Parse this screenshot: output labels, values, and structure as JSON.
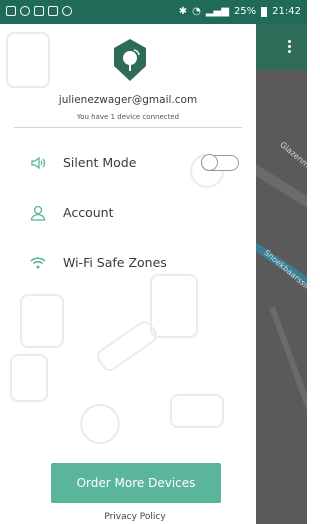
{
  "status_bar": {
    "left_icons": [
      "gallery-icon",
      "whatsapp-icon",
      "image-icon",
      "instagram-icon",
      "chrome-icon"
    ],
    "battery": "25%",
    "time": "21:42"
  },
  "drawer": {
    "email": "julienezwager@gmail.com",
    "devices_text": "You have 1 device connected",
    "items": [
      {
        "label": "Silent Mode",
        "icon": "speaker-icon",
        "toggle_on": false
      },
      {
        "label": "Account",
        "icon": "user-icon"
      },
      {
        "label": "Wi-Fi Safe Zones",
        "icon": "wifi-icon"
      }
    ],
    "order_button": "Order More Devices",
    "privacy_link": "Privacy Policy"
  },
  "map": {
    "street_a": "Glazenm",
    "street_b": "Snoekbaarssing"
  },
  "colors": {
    "status_bar": "#1f6b57",
    "accent": "#5ab59a",
    "dark_green": "#2e6b59"
  }
}
